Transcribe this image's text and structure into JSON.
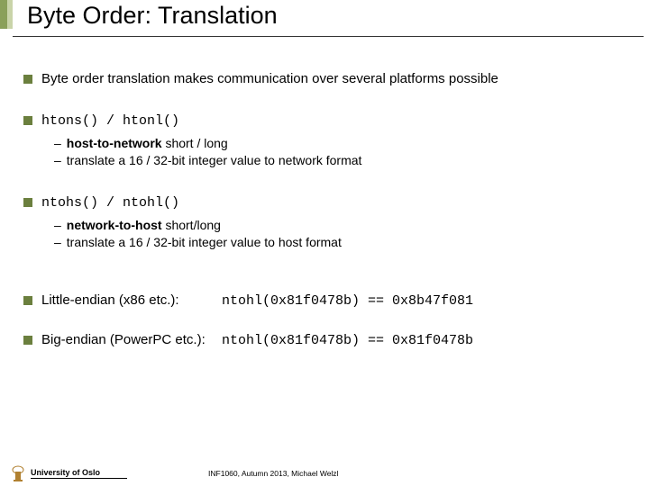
{
  "title": "Byte Order: Translation",
  "bullets": {
    "b1": "Byte order translation makes communication over several platforms possible",
    "b2_code": "htons() / htonl()",
    "b2_s1_pre": "host-to-network",
    "b2_s1_post": " short / long",
    "b2_s2": "translate a 16 / 32-bit integer value to network format",
    "b3_code": "ntohs() / ntohl()",
    "b3_s1_pre": "network-to-host",
    "b3_s1_post": " short/long",
    "b3_s2": "translate a 16 / 32-bit integer value to host format",
    "b4_label": "Little-endian (x86 etc.):",
    "b4_code": "ntohl(0x81f0478b) == 0x8b47f081",
    "b5_label": "Big-endian (PowerPC etc.):",
    "b5_code": "ntohl(0x81f0478b) == 0x81f0478b"
  },
  "footer": {
    "institution": "University of Oslo",
    "course": "INF1060, Autumn 2013, Michael Welzl"
  }
}
